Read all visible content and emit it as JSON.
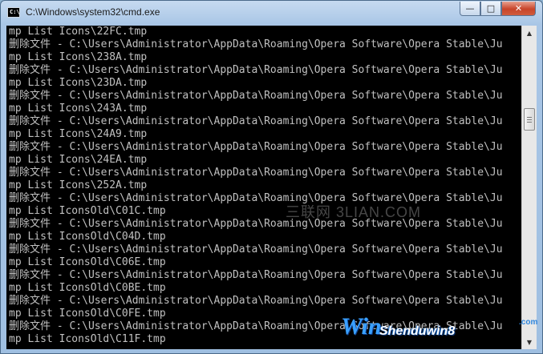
{
  "window": {
    "title": "C:\\Windows\\system32\\cmd.exe",
    "icon_label": "C:\\",
    "controls": {
      "minimize": "—",
      "maximize": "□",
      "close": "✕"
    }
  },
  "console": {
    "lines": [
      "mp List Icons\\22FC.tmp",
      "删除文件 - C:\\Users\\Administrator\\AppData\\Roaming\\Opera Software\\Opera Stable\\Ju",
      "mp List Icons\\238A.tmp",
      "删除文件 - C:\\Users\\Administrator\\AppData\\Roaming\\Opera Software\\Opera Stable\\Ju",
      "mp List Icons\\23DA.tmp",
      "删除文件 - C:\\Users\\Administrator\\AppData\\Roaming\\Opera Software\\Opera Stable\\Ju",
      "mp List Icons\\243A.tmp",
      "删除文件 - C:\\Users\\Administrator\\AppData\\Roaming\\Opera Software\\Opera Stable\\Ju",
      "mp List Icons\\24A9.tmp",
      "删除文件 - C:\\Users\\Administrator\\AppData\\Roaming\\Opera Software\\Opera Stable\\Ju",
      "mp List Icons\\24EA.tmp",
      "删除文件 - C:\\Users\\Administrator\\AppData\\Roaming\\Opera Software\\Opera Stable\\Ju",
      "mp List Icons\\252A.tmp",
      "删除文件 - C:\\Users\\Administrator\\AppData\\Roaming\\Opera Software\\Opera Stable\\Ju",
      "mp List IconsOld\\C01C.tmp",
      "删除文件 - C:\\Users\\Administrator\\AppData\\Roaming\\Opera Software\\Opera Stable\\Ju",
      "mp List IconsOld\\C04D.tmp",
      "删除文件 - C:\\Users\\Administrator\\AppData\\Roaming\\Opera Software\\Opera Stable\\Ju",
      "mp List IconsOld\\C06E.tmp",
      "删除文件 - C:\\Users\\Administrator\\AppData\\Roaming\\Opera Software\\Opera Stable\\Ju",
      "mp List IconsOld\\C0BE.tmp",
      "删除文件 - C:\\Users\\Administrator\\AppData\\Roaming\\Opera Software\\Opera Stable\\Ju",
      "mp List IconsOld\\C0FE.tmp",
      "删除文件 - C:\\Users\\Administrator\\AppData\\Roaming\\Opera Software\\Opera Stable\\Ju",
      "mp List IconsOld\\C11F.tmp"
    ]
  },
  "watermarks": {
    "center": "三联网 3LIAN.COM",
    "logo_w": "Win",
    "logo_domain": "Shenduwin8",
    "logo_com": ".com"
  },
  "colors": {
    "console_bg": "#000000",
    "console_text": "#c0c0c0"
  }
}
